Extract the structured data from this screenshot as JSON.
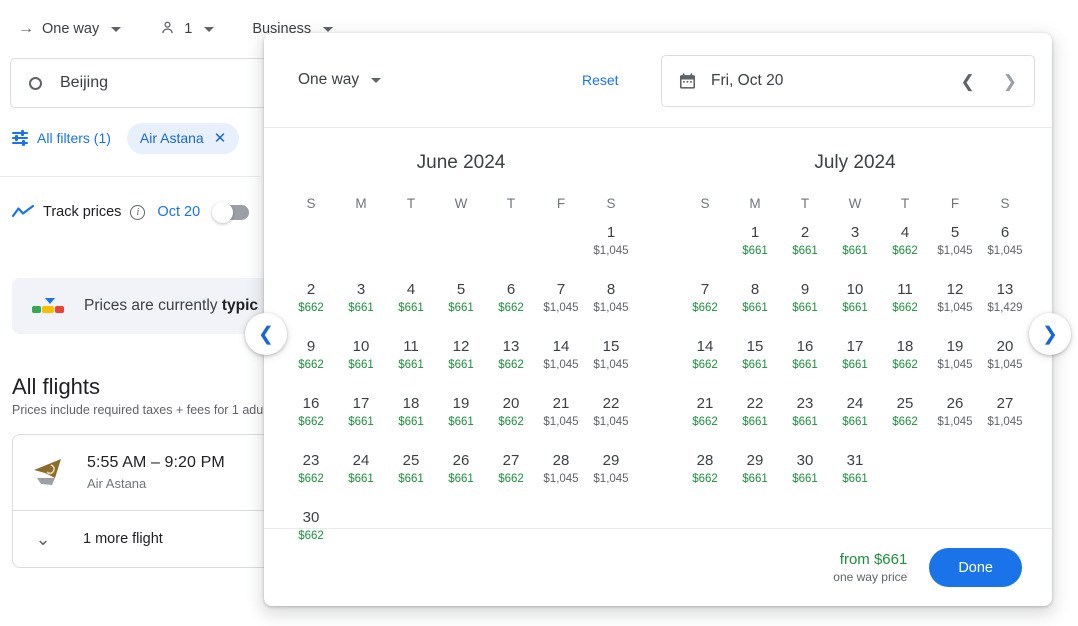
{
  "topbar": {
    "trip_type": "One way",
    "passengers": "1",
    "cabin": "Business",
    "trip_icon": "arrow-right-icon",
    "person_icon": "person-icon"
  },
  "origin": {
    "value": "Beijing",
    "icon": "circle-icon"
  },
  "filters": {
    "all_filters_label": "All filters (1)",
    "chips": [
      {
        "label": "Air Astana",
        "remove_icon": "close-icon"
      }
    ]
  },
  "track_prices": {
    "label": "Track prices",
    "info_icon": "info-icon",
    "date": "Oct 20",
    "toggle_state": "off",
    "chart_icon": "trend-line-icon"
  },
  "price_banner": {
    "text_prefix": "Prices are currently ",
    "text_bold": "typic",
    "gauge_icon": "price-gauge-icon"
  },
  "flights_section": {
    "heading": "All flights",
    "subheading": "Prices include required taxes + fees for 1 adul",
    "cards": [
      {
        "times": "5:55 AM – 9:20 PM",
        "airline": "Air Astana",
        "logo_icon": "air-astana-logo-icon"
      }
    ],
    "more_flights_label": "1 more flight",
    "more_flights_icon": "chevron-down-icon"
  },
  "popup": {
    "trip_type": "One way",
    "reset_label": "Reset",
    "date_value": "Fri, Oct 20",
    "calendar_icon": "calendar-icon",
    "prev_date_icon": "chevron-left-icon",
    "next_date_icon": "chevron-right-icon",
    "footer": {
      "from_price": "from $661",
      "price_sub": "one way price",
      "done_label": "Done"
    }
  },
  "side_nav": {
    "prev_icon": "chevron-left-icon",
    "next_icon": "chevron-right-icon"
  },
  "colors": {
    "accent_blue": "#1a73e8",
    "chip_bg": "#e8f0fe",
    "low_price_green": "#1e8e3e",
    "high_price_gray": "#5f6368",
    "banner_bg": "#f1f3f8"
  },
  "calendar": {
    "dow_labels": [
      "S",
      "M",
      "T",
      "W",
      "T",
      "F",
      "S"
    ],
    "months": [
      {
        "title": "June 2024",
        "lead_blanks": 6,
        "days": [
          {
            "day": 1,
            "price": "$1,045",
            "tier": "hi"
          },
          {
            "day": 2,
            "price": "$662",
            "tier": "low"
          },
          {
            "day": 3,
            "price": "$661",
            "tier": "low"
          },
          {
            "day": 4,
            "price": "$661",
            "tier": "low"
          },
          {
            "day": 5,
            "price": "$661",
            "tier": "low"
          },
          {
            "day": 6,
            "price": "$662",
            "tier": "low"
          },
          {
            "day": 7,
            "price": "$1,045",
            "tier": "hi"
          },
          {
            "day": 8,
            "price": "$1,045",
            "tier": "hi"
          },
          {
            "day": 9,
            "price": "$662",
            "tier": "low"
          },
          {
            "day": 10,
            "price": "$661",
            "tier": "low"
          },
          {
            "day": 11,
            "price": "$661",
            "tier": "low"
          },
          {
            "day": 12,
            "price": "$661",
            "tier": "low"
          },
          {
            "day": 13,
            "price": "$662",
            "tier": "low"
          },
          {
            "day": 14,
            "price": "$1,045",
            "tier": "hi"
          },
          {
            "day": 15,
            "price": "$1,045",
            "tier": "hi"
          },
          {
            "day": 16,
            "price": "$662",
            "tier": "low"
          },
          {
            "day": 17,
            "price": "$661",
            "tier": "low"
          },
          {
            "day": 18,
            "price": "$661",
            "tier": "low"
          },
          {
            "day": 19,
            "price": "$661",
            "tier": "low"
          },
          {
            "day": 20,
            "price": "$662",
            "tier": "low"
          },
          {
            "day": 21,
            "price": "$1,045",
            "tier": "hi"
          },
          {
            "day": 22,
            "price": "$1,045",
            "tier": "hi"
          },
          {
            "day": 23,
            "price": "$662",
            "tier": "low"
          },
          {
            "day": 24,
            "price": "$661",
            "tier": "low"
          },
          {
            "day": 25,
            "price": "$661",
            "tier": "low"
          },
          {
            "day": 26,
            "price": "$661",
            "tier": "low"
          },
          {
            "day": 27,
            "price": "$662",
            "tier": "low"
          },
          {
            "day": 28,
            "price": "$1,045",
            "tier": "hi"
          },
          {
            "day": 29,
            "price": "$1,045",
            "tier": "hi"
          },
          {
            "day": 30,
            "price": "$662",
            "tier": "low"
          }
        ]
      },
      {
        "title": "July 2024",
        "lead_blanks": 1,
        "days": [
          {
            "day": 1,
            "price": "$661",
            "tier": "low"
          },
          {
            "day": 2,
            "price": "$661",
            "tier": "low"
          },
          {
            "day": 3,
            "price": "$661",
            "tier": "low"
          },
          {
            "day": 4,
            "price": "$662",
            "tier": "low"
          },
          {
            "day": 5,
            "price": "$1,045",
            "tier": "hi"
          },
          {
            "day": 6,
            "price": "$1,045",
            "tier": "hi"
          },
          {
            "day": 7,
            "price": "$662",
            "tier": "low"
          },
          {
            "day": 8,
            "price": "$661",
            "tier": "low"
          },
          {
            "day": 9,
            "price": "$661",
            "tier": "low"
          },
          {
            "day": 10,
            "price": "$661",
            "tier": "low"
          },
          {
            "day": 11,
            "price": "$662",
            "tier": "low"
          },
          {
            "day": 12,
            "price": "$1,045",
            "tier": "hi"
          },
          {
            "day": 13,
            "price": "$1,429",
            "tier": "hi"
          },
          {
            "day": 14,
            "price": "$662",
            "tier": "low"
          },
          {
            "day": 15,
            "price": "$661",
            "tier": "low"
          },
          {
            "day": 16,
            "price": "$661",
            "tier": "low"
          },
          {
            "day": 17,
            "price": "$661",
            "tier": "low"
          },
          {
            "day": 18,
            "price": "$662",
            "tier": "low"
          },
          {
            "day": 19,
            "price": "$1,045",
            "tier": "hi"
          },
          {
            "day": 20,
            "price": "$1,045",
            "tier": "hi"
          },
          {
            "day": 21,
            "price": "$662",
            "tier": "low"
          },
          {
            "day": 22,
            "price": "$661",
            "tier": "low"
          },
          {
            "day": 23,
            "price": "$661",
            "tier": "low"
          },
          {
            "day": 24,
            "price": "$661",
            "tier": "low"
          },
          {
            "day": 25,
            "price": "$662",
            "tier": "low"
          },
          {
            "day": 26,
            "price": "$1,045",
            "tier": "hi"
          },
          {
            "day": 27,
            "price": "$1,045",
            "tier": "hi"
          },
          {
            "day": 28,
            "price": "$662",
            "tier": "low"
          },
          {
            "day": 29,
            "price": "$661",
            "tier": "low"
          },
          {
            "day": 30,
            "price": "$661",
            "tier": "low"
          },
          {
            "day": 31,
            "price": "$661",
            "tier": "low"
          }
        ]
      }
    ]
  }
}
